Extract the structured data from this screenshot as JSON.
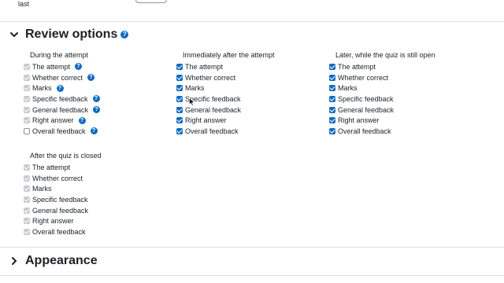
{
  "top": {
    "text": "last"
  },
  "review": {
    "title": "Review options",
    "groups": [
      {
        "title": "During the attempt",
        "items": [
          {
            "label": "The attempt",
            "state": "disabled-checked",
            "help": true
          },
          {
            "label": "Whether correct",
            "state": "disabled-checked",
            "help": true
          },
          {
            "label": "Marks",
            "state": "disabled-checked",
            "help": true
          },
          {
            "label": "Specific feedback",
            "state": "disabled-checked",
            "help": true
          },
          {
            "label": "General feedback",
            "state": "disabled-checked",
            "help": true
          },
          {
            "label": "Right answer",
            "state": "disabled-checked",
            "help": true
          },
          {
            "label": "Overall feedback",
            "state": "empty",
            "help": true
          }
        ]
      },
      {
        "title": "Immediately after the attempt",
        "items": [
          {
            "label": "The attempt",
            "state": "checked"
          },
          {
            "label": "Whether correct",
            "state": "checked"
          },
          {
            "label": "Marks",
            "state": "checked"
          },
          {
            "label": "Specific feedback",
            "state": "checked"
          },
          {
            "label": "General feedback",
            "state": "checked"
          },
          {
            "label": "Right answer",
            "state": "checked"
          },
          {
            "label": "Overall feedback",
            "state": "checked"
          }
        ]
      },
      {
        "title": "Later, while the quiz is still open",
        "items": [
          {
            "label": "The attempt",
            "state": "checked"
          },
          {
            "label": "Whether correct",
            "state": "checked"
          },
          {
            "label": "Marks",
            "state": "checked"
          },
          {
            "label": "Specific feedback",
            "state": "checked"
          },
          {
            "label": "General feedback",
            "state": "checked"
          },
          {
            "label": "Right answer",
            "state": "checked"
          },
          {
            "label": "Overall feedback",
            "state": "checked"
          }
        ]
      },
      {
        "title": "After the quiz is closed",
        "items": [
          {
            "label": "The attempt",
            "state": "disabled-checked"
          },
          {
            "label": "Whether correct",
            "state": "disabled-checked"
          },
          {
            "label": "Marks",
            "state": "disabled-checked"
          },
          {
            "label": "Specific feedback",
            "state": "disabled-checked"
          },
          {
            "label": "General feedback",
            "state": "disabled-checked"
          },
          {
            "label": "Right answer",
            "state": "disabled-checked"
          },
          {
            "label": "Overall feedback",
            "state": "disabled-checked"
          }
        ]
      }
    ]
  },
  "appearance": {
    "title": "Appearance"
  },
  "help_glyph": "?",
  "colors": {
    "accent": "#0f6cbf",
    "disabled": "#c7cbd1",
    "divider": "#dee2e6"
  }
}
